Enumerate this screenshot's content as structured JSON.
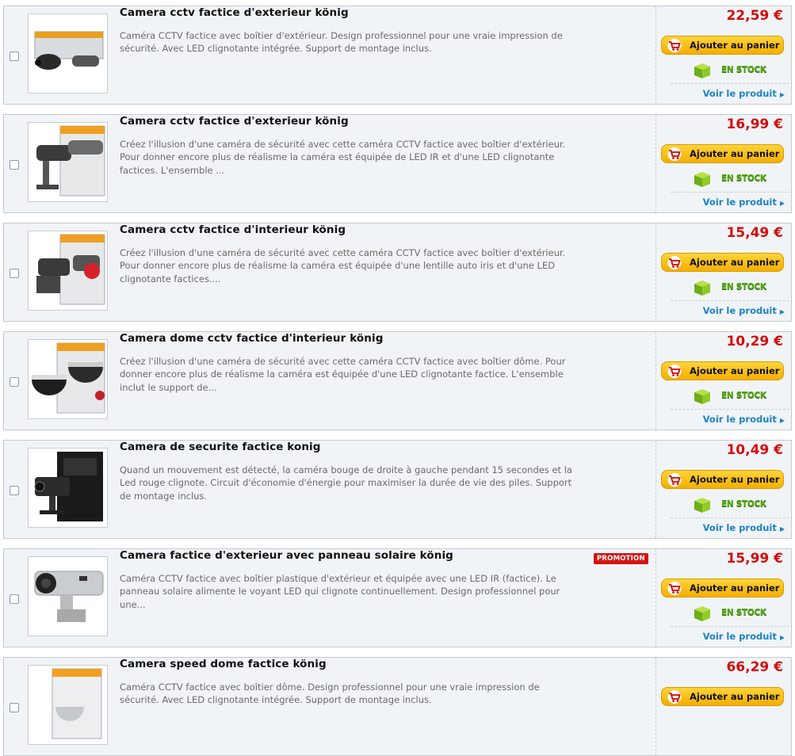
{
  "cart_label": "Ajouter au panier",
  "stock_label": "EN STOCK",
  "voir_label": "Voir le produit",
  "colors": {
    "price": "#d50b0b",
    "link": "#1c83c6",
    "button": "#ffc21a",
    "promo": "#d41414",
    "stock": "#53a80f"
  },
  "products": [
    {
      "title": "Camera cctv factice d'exterieur könig",
      "description": "Caméra CCTV factice avec boîtier d'extérieur. Design professionnel pour une vraie impression de sécurité. Avec LED clignotante intégrée. Support de montage inclus.",
      "price": "22,59 €",
      "promo": ""
    },
    {
      "title": "Camera cctv factice d'exterieur könig",
      "description": "Créez l'illusion d'une caméra de sécurité avec cette caméra CCTV factice avec boîtier d'extérieur. Pour donner encore plus de réalisme la caméra est équipée de LED IR et d'une LED clignotante factices. L'ensemble ...",
      "price": "16,99 €",
      "promo": ""
    },
    {
      "title": "Camera cctv factice d'interieur könig",
      "description": "Créez l'illusion d'une caméra de sécurité avec cette caméra CCTV factice avec boîtier d'extérieur. Pour donner encore plus de réalisme la caméra est équipée d'une lentille auto iris et d'une LED clignotante factices....",
      "price": "15,49 €",
      "promo": ""
    },
    {
      "title": "Camera dome cctv factice d'interieur könig",
      "description": "Créez l'illusion d'une caméra de sécurité avec cette caméra CCTV factice avec boîtier dôme. Pour donner encore plus de réalisme la caméra est équipée d'une LED clignotante factice. L'ensemble inclut le support de...",
      "price": "10,29 €",
      "promo": ""
    },
    {
      "title": "Camera de securite factice konig",
      "description": "Quand un mouvement est détecté, la caméra bouge de droite à gauche pendant 15 secondes et la Led rouge clignote. Circuit d'économie d'énergie pour maximiser la durée de vie des piles. Support de montage inclus.",
      "price": "10,49 €",
      "promo": ""
    },
    {
      "title": "Camera factice d'exterieur avec panneau solaire könig",
      "description": "Caméra CCTV factice avec boîtier plastique d'extérieur et équipée avec une LED IR (factice). Le panneau solaire alimente le voyant LED qui clignote continuellement. Design professionnel pour une...",
      "price": "15,99 €",
      "promo": "PROMOTION"
    },
    {
      "title": "Camera speed dome factice könig",
      "description": "Caméra CCTV factice avec boîtier dôme. Design professionnel pour une vraie impression de sécurité. Avec LED clignotante intégrée. Support de montage inclus.",
      "price": "66,29 €",
      "promo": ""
    }
  ]
}
